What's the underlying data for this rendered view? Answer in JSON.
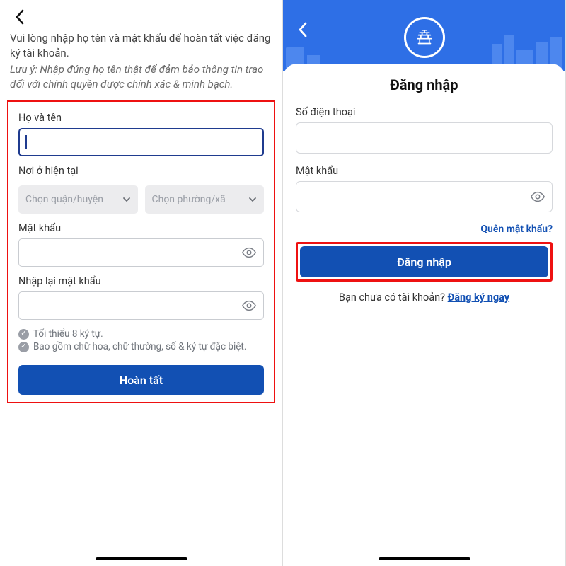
{
  "left": {
    "intro_main": "Vui lòng nhập họ tên và mật khẩu để hoàn tất việc đăng ký tài khoản.",
    "intro_note": "Lưu ý: Nhập đúng họ tên thật để đảm bảo thông tin trao đổi với chính quyền được chính xác & minh bạch.",
    "name_label": "Họ và tên",
    "location_label": "Nơi ở hiện tại",
    "district_placeholder": "Chọn quận/huyện",
    "ward_placeholder": "Chọn phường/xã",
    "password_label": "Mật khẩu",
    "password2_label": "Nhập lại mật khẩu",
    "rule1": "Tối thiểu 8 ký tự.",
    "rule2": "Bao gồm chữ hoa, chữ thường, số & ký tự đặc biệt.",
    "submit": "Hoàn tất"
  },
  "right": {
    "title": "Đăng nhập",
    "phone_label": "Số điện thoại",
    "password_label": "Mật khẩu",
    "forgot": "Quên mật khẩu?",
    "login": "Đăng nhập",
    "signup_prompt": "Bạn chưa có tài khoản? ",
    "signup_link": "Đăng ký ngay"
  }
}
